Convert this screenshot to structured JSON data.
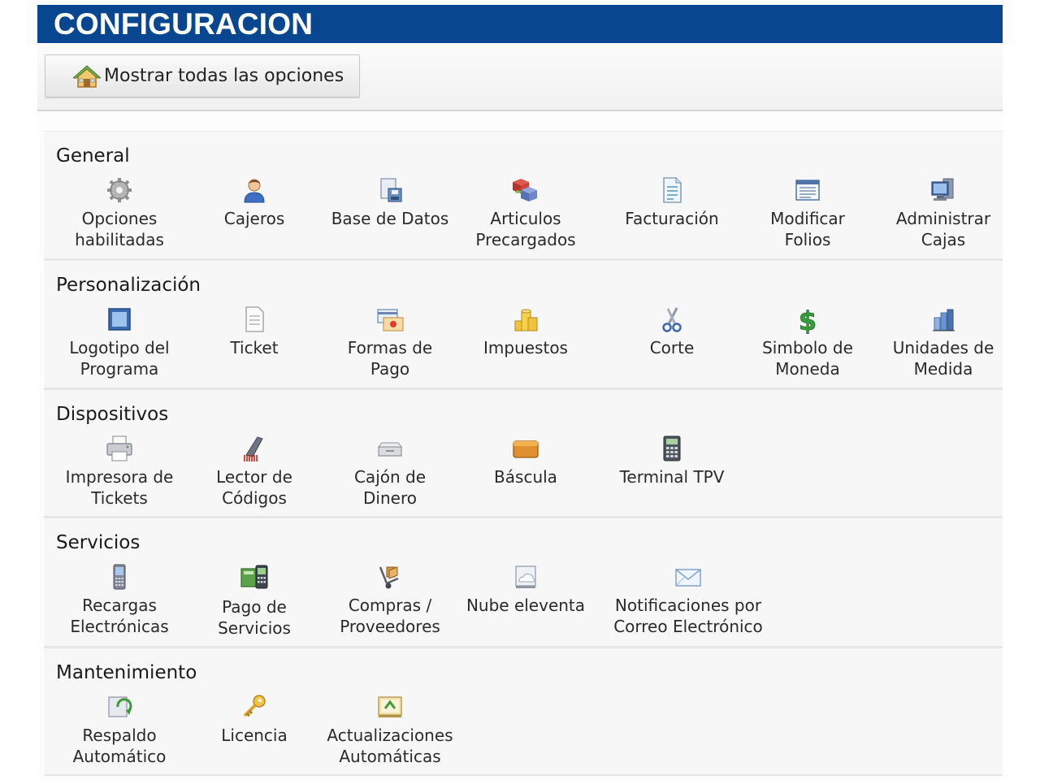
{
  "header": {
    "title": "CONFIGURACION"
  },
  "toolbar": {
    "show_all_label": "Mostrar todas las opciones"
  },
  "sections": [
    {
      "title": "General",
      "items": [
        {
          "label": "Opciones\nhabilitadas",
          "icon": "gear-icon"
        },
        {
          "label": "Cajeros",
          "icon": "user-icon"
        },
        {
          "label": "Base de Datos",
          "icon": "database-icon"
        },
        {
          "label": "Articulos\nPrecargados",
          "icon": "boxes-icon"
        },
        {
          "label": "Facturación",
          "icon": "invoice-icon"
        },
        {
          "label": "Modificar\nFolios",
          "icon": "folio-icon"
        },
        {
          "label": "Administrar\nCajas",
          "icon": "computer-icon"
        }
      ]
    },
    {
      "title": "Personalización",
      "items": [
        {
          "label": "Logotipo del\nPrograma",
          "icon": "picture-icon"
        },
        {
          "label": "Ticket",
          "icon": "document-icon"
        },
        {
          "label": "Formas de\nPago",
          "icon": "payment-card-icon"
        },
        {
          "label": "Impuestos",
          "icon": "coins-icon"
        },
        {
          "label": "Corte",
          "icon": "scissors-icon"
        },
        {
          "label": "Simbolo de\nMoneda",
          "icon": "dollar-icon"
        },
        {
          "label": "Unidades de\nMedida",
          "icon": "bar-chart-icon"
        }
      ]
    },
    {
      "title": "Dispositivos",
      "items": [
        {
          "label": "Impresora de\nTickets",
          "icon": "printer-icon"
        },
        {
          "label": "Lector de\nCódigos",
          "icon": "barcode-scanner-icon"
        },
        {
          "label": "Cajón de\nDinero",
          "icon": "cash-drawer-icon"
        },
        {
          "label": "Báscula",
          "icon": "scale-icon"
        },
        {
          "label": "Terminal TPV",
          "icon": "pos-terminal-icon"
        }
      ]
    },
    {
      "title": "Servicios",
      "items": [
        {
          "label": "Recargas\nElectrónicas",
          "icon": "mobile-phone-icon"
        },
        {
          "label": "Pago de\nServicios",
          "icon": "service-payment-icon"
        },
        {
          "label": "Compras /\nProveedores",
          "icon": "hand-truck-icon"
        },
        {
          "label": "Nube eleventa",
          "icon": "cloud-icon"
        },
        {
          "label": "Notificaciones por\nCorreo Electrónico",
          "icon": "envelope-icon"
        }
      ]
    },
    {
      "title": "Mantenimiento",
      "items": [
        {
          "label": "Respaldo\nAutomático",
          "icon": "backup-icon"
        },
        {
          "label": "Licencia",
          "icon": "key-icon"
        },
        {
          "label": "Actualizaciones\nAutomáticas",
          "icon": "update-icon"
        }
      ]
    }
  ]
}
